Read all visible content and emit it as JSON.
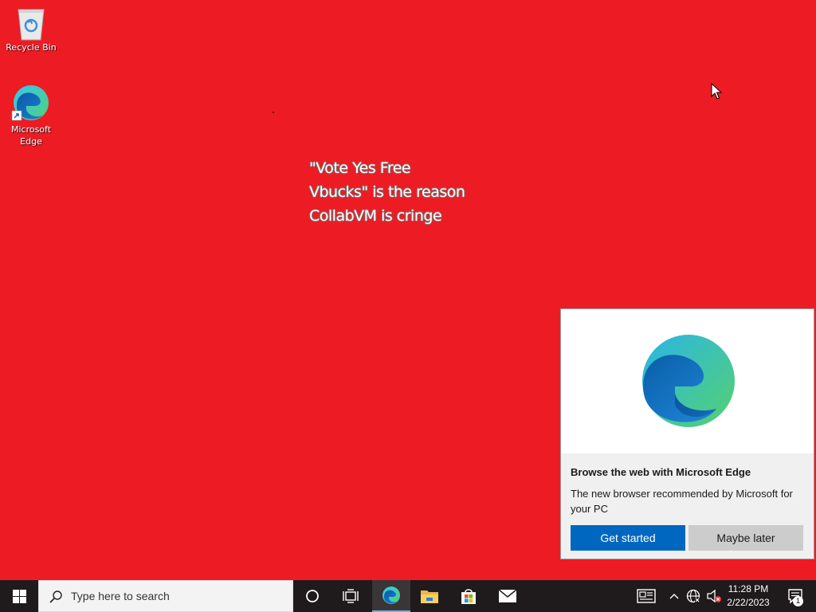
{
  "colors": {
    "desktop_background": "#ED1C24",
    "taskbar": "#1F1A1B",
    "accent_button": "#0067C0",
    "secondary_button": "#CCCCCC"
  },
  "desktop": {
    "icons": [
      {
        "label": "Recycle Bin",
        "icon": "recycle-bin-icon"
      },
      {
        "label": "Microsoft Edge",
        "label_line1": "Microsoft",
        "label_line2": "Edge",
        "icon": "microsoft-edge-icon"
      }
    ],
    "wallpaper_text": [
      "\"Vote Yes Free",
      "Vbucks\" is the reason",
      "CollabVM is cringe"
    ]
  },
  "toast": {
    "icon": "microsoft-edge-logo",
    "title": "Browse the web with Microsoft Edge",
    "body": "The new browser recommended by Microsoft for your PC",
    "primary_button": "Get started",
    "secondary_button": "Maybe later"
  },
  "taskbar": {
    "start_icon": "windows-start-icon",
    "search_placeholder": "Type here to search",
    "pinned": [
      "cortana-icon",
      "task-view-icon",
      "microsoft-edge-icon",
      "file-explorer-icon",
      "microsoft-store-icon",
      "mail-icon"
    ],
    "tray": {
      "icons": [
        "news-and-interests-icon",
        "show-hidden-icons-chevron",
        "network-icon",
        "volume-muted-icon"
      ],
      "time": "11:28 PM",
      "date": "2/22/2023",
      "notification_count": "1"
    }
  }
}
